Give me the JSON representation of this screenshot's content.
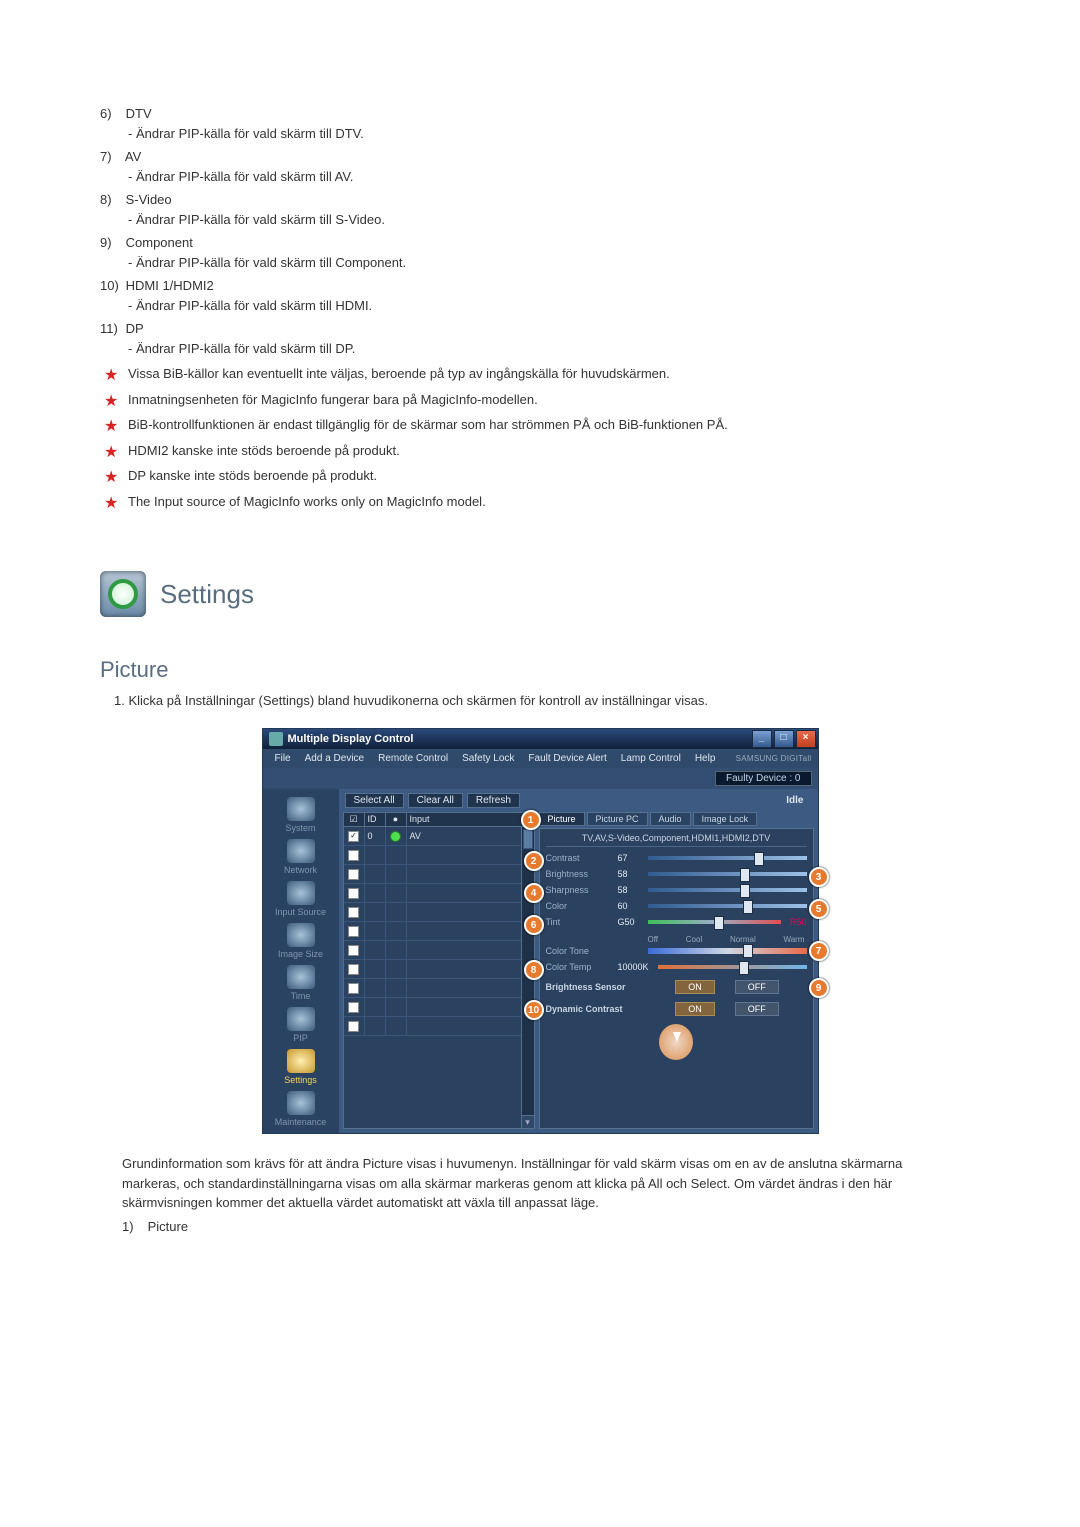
{
  "items": [
    {
      "num": "6)",
      "title": "DTV",
      "desc": "- Ändrar PIP-källa för vald skärm till DTV."
    },
    {
      "num": "7)",
      "title": "AV",
      "desc": "- Ändrar PIP-källa för vald skärm till AV."
    },
    {
      "num": "8)",
      "title": "S-Video",
      "desc": "- Ändrar PIP-källa för vald skärm till S-Video."
    },
    {
      "num": "9)",
      "title": "Component",
      "desc": "- Ändrar PIP-källa för vald skärm till Component."
    },
    {
      "num": "10)",
      "title": "HDMI 1/HDMI2",
      "desc": "- Ändrar PIP-källa för vald skärm till HDMI."
    },
    {
      "num": "11)",
      "title": "DP",
      "desc": "- Ändrar PIP-källa för vald skärm till DP."
    }
  ],
  "stars": [
    "Vissa BiB-källor kan eventuellt inte väljas, beroende på typ av ingångskälla för huvudskärmen.",
    "Inmatningsenheten för MagicInfo fungerar bara på MagicInfo-modellen.",
    "BiB-kontrollfunktionen är endast tillgänglig för de skärmar som har strömmen PÅ och BiB-funktionen PÅ.",
    "HDMI2 kanske inte stöds beroende på produkt.",
    "DP kanske inte stöds beroende på produkt.",
    "The Input source of MagicInfo works only on MagicInfo model."
  ],
  "settingsTitle": "Settings",
  "pictureTitle": "Picture",
  "introNum": "1.",
  "introText": "Klicka på Inställningar (Settings) bland huvudikonerna och skärmen för kontroll av inställningar visas.",
  "mdc": {
    "title": "Multiple Display Control",
    "menus": [
      "File",
      "Add a Device",
      "Remote Control",
      "Safety Lock",
      "Fault Device Alert",
      "Lamp Control",
      "Help"
    ],
    "brand": "SAMSUNG DIGITall",
    "faulty": "Faulty Device : 0",
    "toolbar": {
      "selectAll": "Select All",
      "clearAll": "Clear All",
      "refresh": "Refresh",
      "idle": "Idle"
    },
    "gridHdr": {
      "c1": "☑",
      "c2": "ID",
      "c3": "●",
      "c4": "Input"
    },
    "row0": {
      "id": "0",
      "input": "AV"
    },
    "sidebar": [
      "System",
      "Network",
      "Input Source",
      "Image Size",
      "Time",
      "PIP",
      "Settings",
      "Maintenance"
    ],
    "tabs": [
      "Picture",
      "Picture PC",
      "Audio",
      "Image Lock"
    ],
    "panelHdr": "TV,AV,S-Video,Component,HDMI1,HDMI2,DTV",
    "rows": {
      "contrast": {
        "label": "Contrast",
        "val": "67"
      },
      "brightness": {
        "label": "Brightness",
        "val": "58"
      },
      "sharpness": {
        "label": "Sharpness",
        "val": "58"
      },
      "color": {
        "label": "Color",
        "val": "60"
      },
      "tint": {
        "label": "Tint",
        "left": "G50",
        "right": "R50"
      },
      "colortone": {
        "label": "Color Tone",
        "marks": [
          "Off",
          "Cool",
          "Normal",
          "Warm"
        ]
      },
      "colortemp": {
        "label": "Color Temp",
        "val": "10000K"
      },
      "bsense": {
        "label": "Brightness Sensor",
        "on": "ON",
        "off": "OFF"
      },
      "dyn": {
        "label": "Dynamic Contrast",
        "on": "ON",
        "off": "OFF"
      }
    }
  },
  "footerPara": "Grundinformation som krävs för att ändra Picture visas i huvumenyn. Inställningar för vald skärm visas om en av de anslutna skärmarna markeras, och standardinställningarna visas om alla skärmar markeras genom att klicka på All och Select. Om värdet ändras i den här skärmvisningen kommer det aktuella värdet automatiskt att växla till anpassat läge.",
  "footerListNum": "1)",
  "footerListTxt": "Picture"
}
